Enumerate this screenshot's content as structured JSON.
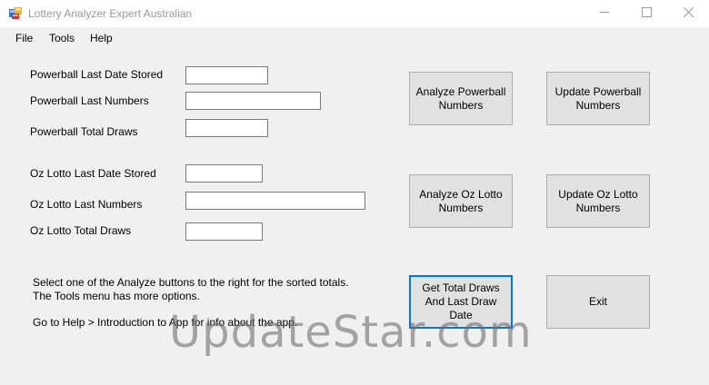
{
  "window": {
    "title": "Lottery Analyzer Expert Australian",
    "minimize_icon": "minimize-icon",
    "maximize_icon": "maximize-icon",
    "close_icon": "close-icon"
  },
  "menu": {
    "items": [
      "File",
      "Tools",
      "Help"
    ]
  },
  "powerball": {
    "last_date_label": "Powerball Last Date Stored",
    "last_date_value": "",
    "last_numbers_label": "Powerball Last Numbers",
    "last_numbers_value": "",
    "total_draws_label": "Powerball Total Draws",
    "total_draws_value": ""
  },
  "ozlotto": {
    "last_date_label": "Oz Lotto Last Date Stored",
    "last_date_value": "",
    "last_numbers_label": "Oz Lotto Last Numbers",
    "last_numbers_value": "",
    "total_draws_label": "Oz Lotto Total Draws",
    "total_draws_value": ""
  },
  "buttons": {
    "analyze_powerball": "Analyze Powerball\nNumbers",
    "update_powerball": "Update Powerball\nNumbers",
    "analyze_ozlotto": "Analyze Oz Lotto\nNumbers",
    "update_ozlotto": "Update Oz Lotto\nNumbers",
    "get_total_draws": "Get Total Draws\nAnd Last Draw\nDate",
    "exit": "Exit"
  },
  "info": {
    "line1": "Select one of the Analyze buttons to the right for the sorted totals.",
    "line2": "The Tools menu has more options.",
    "line3": "Go to Help > Introduction to App for info about the app."
  },
  "watermark": "UpdateStar.com",
  "colors": {
    "accent": "#0078d7",
    "button_face": "#e1e1e1",
    "window_bg": "#f0f0f0"
  }
}
